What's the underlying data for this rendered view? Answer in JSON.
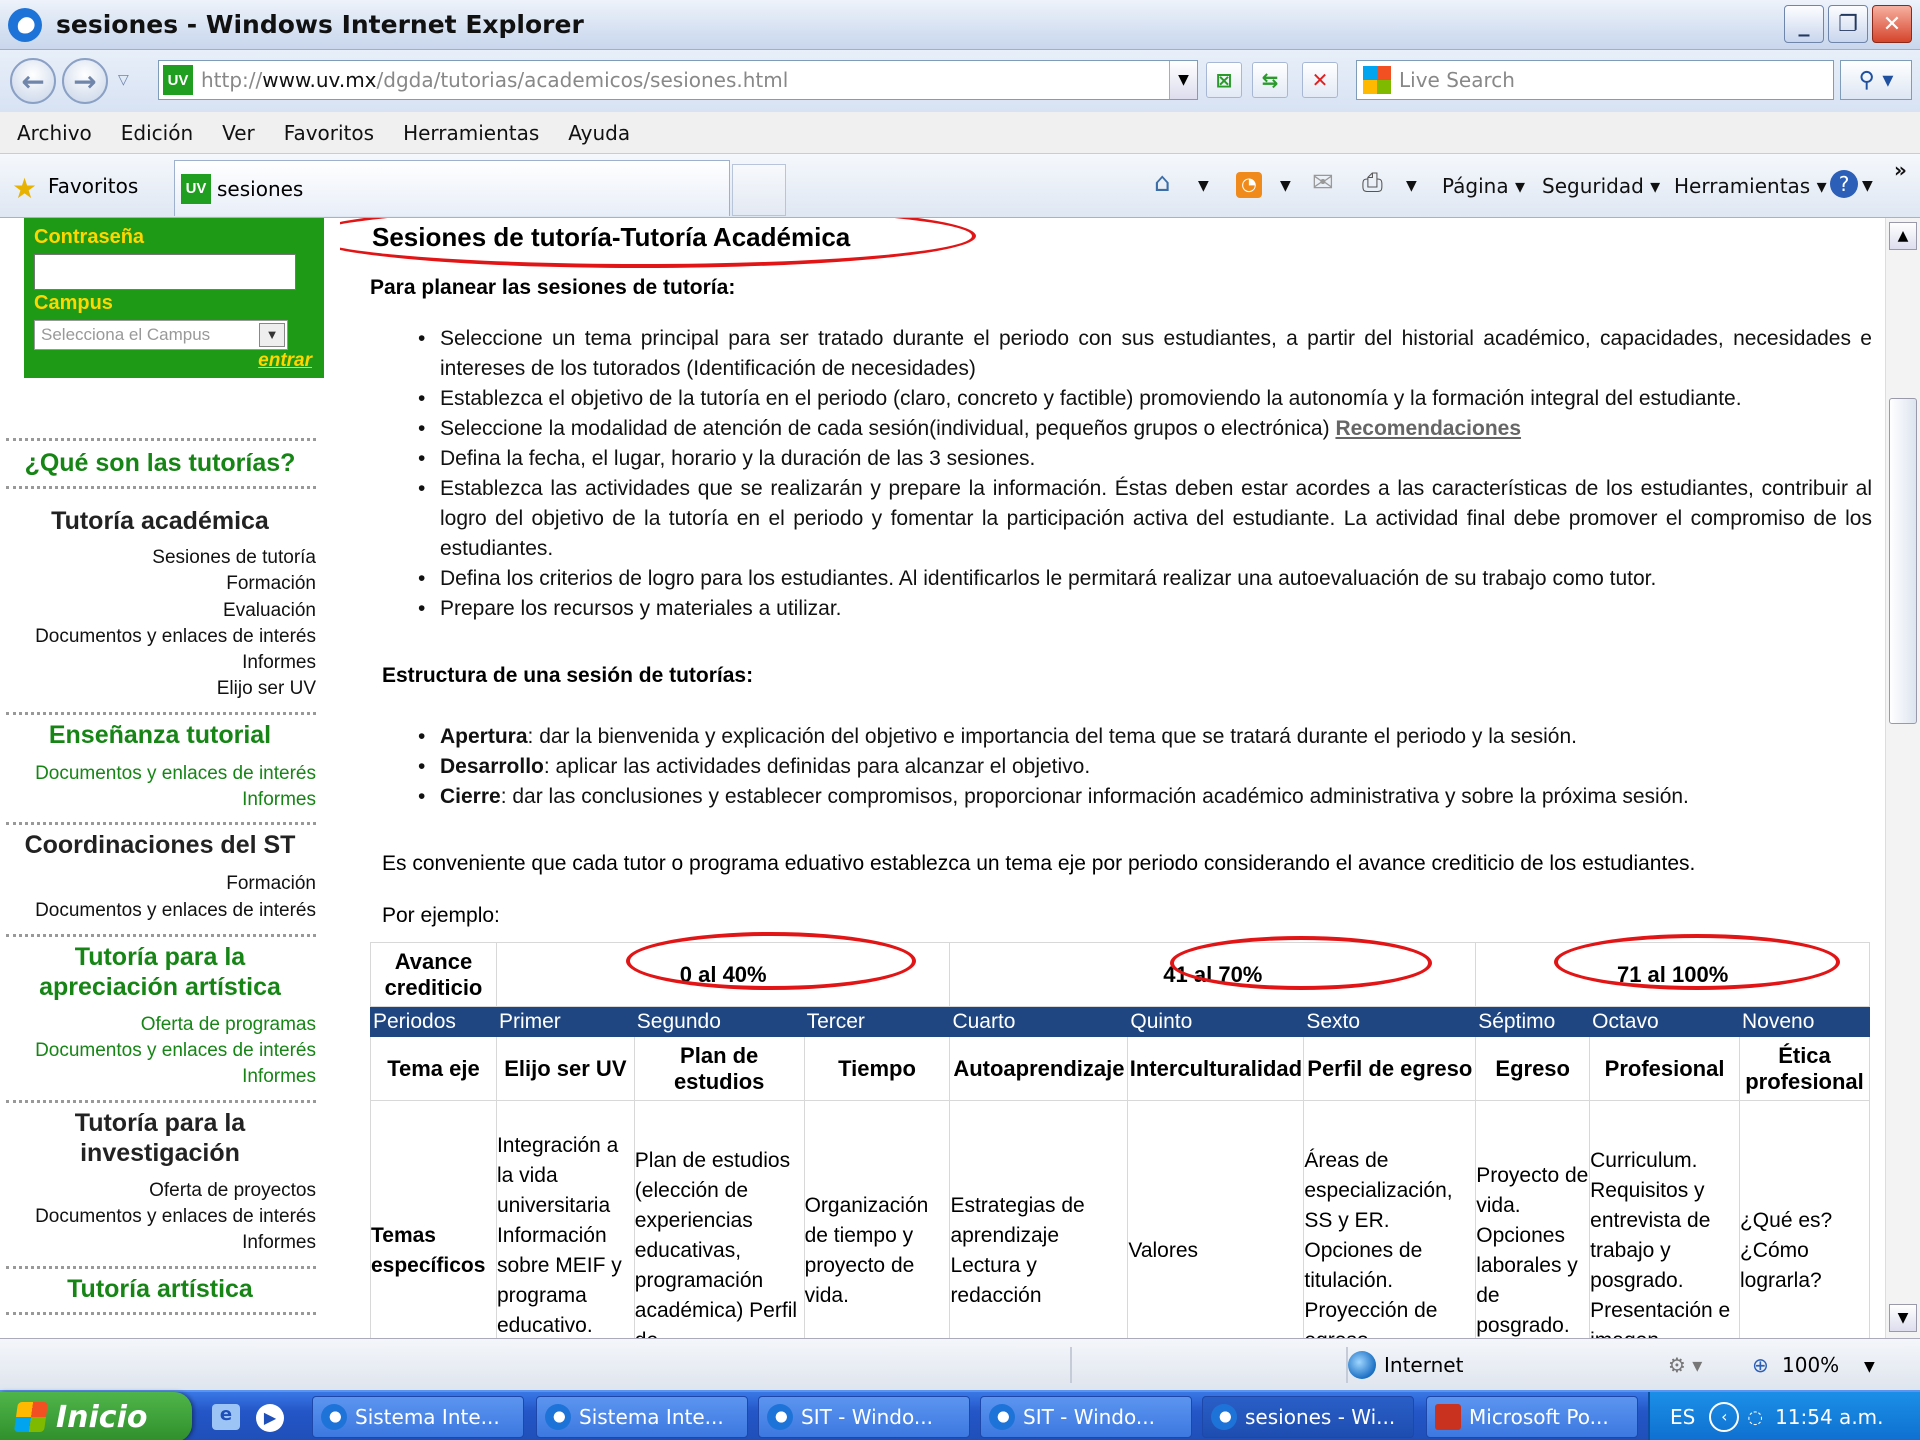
{
  "window": {
    "title": "sesiones - Windows Internet Explorer",
    "min": "_",
    "max": "❐",
    "close": "✕"
  },
  "address": {
    "url_prefix": "http://",
    "url_host": "www.uv.mx",
    "url_path": "/dgda/tutorias/academicos/sesiones.html",
    "search_placeholder": "Live Search"
  },
  "menu": [
    "Archivo",
    "Edición",
    "Ver",
    "Favoritos",
    "Herramientas",
    "Ayuda"
  ],
  "favbar": {
    "favorites_label": "Favoritos",
    "tab_label": "sesiones",
    "badge": "UV",
    "pagina": "Página ▾",
    "seguridad": "Seguridad ▾",
    "herramientas": "Herramientas ▾"
  },
  "sidebar": {
    "contrasena": "Contraseña",
    "campus": "Campus",
    "campus_select": "Selecciona el Campus",
    "entrar": "entrar",
    "que_son": "¿Qué son las tutorías?",
    "tutoria_academica": "Tutoría académica",
    "ta_links": [
      "Sesiones de tutoría",
      "Formación",
      "Evaluación",
      "Documentos y enlaces de interés",
      "Informes",
      "Elijo ser UV"
    ],
    "ensenanza": "Enseñanza tutorial",
    "en_links": [
      "Documentos y enlaces de interés",
      "Informes"
    ],
    "coordinaciones": "Coordinaciones del ST",
    "co_links": [
      "Formación",
      "Documentos y enlaces de interés"
    ],
    "apreciacion_1": "Tutoría para la",
    "apreciacion_2": "apreciación artística",
    "ap_links": [
      "Oferta de programas",
      "Documentos y enlaces de interés",
      "Informes"
    ],
    "investigacion_1": "Tutoría para la",
    "investigacion_2": "investigación",
    "in_links": [
      "Oferta de proyectos",
      "Documentos y enlaces de interés",
      "Informes"
    ],
    "artistica": "Tutoría artística"
  },
  "content": {
    "title": "Sesiones de tutoría-Tutoría Académica",
    "planear_heading": "Para planear las sesiones de tutoría:",
    "planear_items": [
      "Seleccione un tema principal para ser tratado durante el periodo con sus estudiantes, a partir del historial académico, capacidades, necesidades e intereses de los tutorados (Identificación de necesidades)",
      "Establezca el objetivo de la tutoría en el periodo (claro, concreto y factible) promoviendo la autonomía y la formación integral del estudiante.",
      "Seleccione la modalidad de atención de cada sesión(individual, pequeños grupos o electrónica)",
      "Defina la fecha, el lugar, horario y la duración de las 3 sesiones.",
      "Establezca las actividades que se realizarán y prepare la información. Éstas deben estar acordes a las características de los estudiantes, contribuir al logro del objetivo de la tutoría en el periodo y fomentar la participación activa del estudiante. La actividad final debe promover el compromiso de los estudiantes.",
      "Defina los criterios de logro para los estudiantes. Al identificarlos le permitará realizar una autoevaluación de su trabajo como tutor.",
      "Prepare los recursos y materiales a utilizar."
    ],
    "recomendaciones_link": "Recomendaciones",
    "estructura_heading": "Estructura de una sesión de tutorías:",
    "estructura_items": [
      {
        "term": "Apertura",
        "text": ": dar la bienvenida y explicación del objetivo e importancia del tema que se tratará durante el periodo y la sesión."
      },
      {
        "term": "Desarrollo",
        "text": ": aplicar las actividades definidas para alcanzar el objetivo."
      },
      {
        "term": "Cierre",
        "text": ": dar las conclusiones y establecer compromisos,  proporcionar información académico administrativa y sobre la próxima sesión."
      }
    ],
    "conveniente": "Es conveniente que cada tutor o programa eduativo establezca un tema eje por periodo considerando el avance crediticio de los estudiantes.",
    "por_ejemplo": "Por ejemplo:"
  },
  "table": {
    "avance_label": "Avance crediticio",
    "ranges": [
      "0 al 40%",
      "41 al 70%",
      "71 al 100%"
    ],
    "periodos_label": "Periodos",
    "periodos": [
      "Primer",
      "Segundo",
      "Tercer",
      "Cuarto",
      "Quinto",
      "Sexto",
      "Séptimo",
      "Octavo",
      "Noveno"
    ],
    "tema_eje_label": "Tema eje",
    "temas_eje": [
      "Elijo ser UV",
      "Plan de estudios",
      "Tiempo",
      "Autoaprendizaje",
      "Interculturalidad",
      "Perfil de egreso",
      "Egreso",
      "Profesional",
      "Ética profesional"
    ],
    "especificos_label": "Temas específicos",
    "especificos": [
      "Integración a la vida universitaria Información sobre MEIF y programa educativo. Formación",
      "Plan de estudios (elección de experiencias educativas, programación académica) Perfil de",
      "Organización de tiempo y proyecto de vida.",
      "Estrategias de aprendizaje Lectura y redacción",
      "Valores",
      "Áreas de especialización, SS y ER. Opciones de titulación. Proyección de egreso",
      "Proyecto de vida. Opciones laborales y de posgrado.",
      "Curriculum. Requisitos y entrevista de trabajo y posgrado. Presentación e imagen",
      "¿Qué es? ¿Cómo lograrla?"
    ]
  },
  "status": {
    "zone": "Internet",
    "zoom": "100%"
  },
  "taskbar": {
    "start": "Inicio",
    "items": [
      "Sistema Inte...",
      "Sistema Inte...",
      "SIT - Windo...",
      "SIT - Windo...",
      "sesiones - Wi...",
      "Microsoft Po..."
    ],
    "lang": "ES",
    "clock": "11:54 a.m."
  },
  "colors": {
    "sidebar_green": "#1f9a16",
    "heading_green": "#168516",
    "table_header": "#1f4680",
    "annotation_red": "#e11515"
  }
}
